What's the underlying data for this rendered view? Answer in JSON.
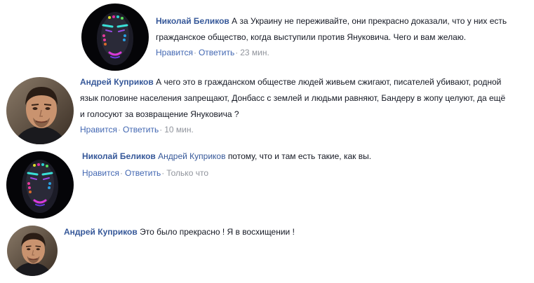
{
  "comments": [
    {
      "author": "Николай Беликов",
      "mention": "",
      "text": "А за Украину не переживайте, они прекрасно доказали, что у них есть гражданское общество, когда выступили против Януковича. Чего и вам желаю.",
      "like": "Нравится",
      "reply": "Ответить",
      "time": "23 мин.",
      "avatar_icon": "masked-face-icon"
    },
    {
      "author": "Андрей Куприков",
      "mention": "",
      "text": "А чего это в гражданском обществе людей живьем сжигают, писателей убивают, родной язык половине населения запрещают, Донбасс с землей и людьми равняют, Бандеру в жопу целуют, да ещё и голосуют за возвращение Януковича ?",
      "like": "Нравится",
      "reply": "Ответить",
      "time": "10 мин.",
      "avatar_icon": "man-face-icon"
    },
    {
      "author": "Николай Беликов",
      "mention": "Андрей Куприков",
      "text": "потому, что и там есть такие, как вы.",
      "like": "Нравится",
      "reply": "Ответить",
      "time": "Только что",
      "avatar_icon": "masked-face-icon"
    },
    {
      "author": "Андрей Куприков",
      "mention": "",
      "text": "Это было прекрасно ! Я в восхищении !",
      "like": "",
      "reply": "",
      "time": "",
      "avatar_icon": "man-face-icon"
    }
  ],
  "separator": "·",
  "colors": {
    "link": "#365899",
    "action": "#4267b2",
    "meta": "#90949c",
    "text": "#141823"
  }
}
